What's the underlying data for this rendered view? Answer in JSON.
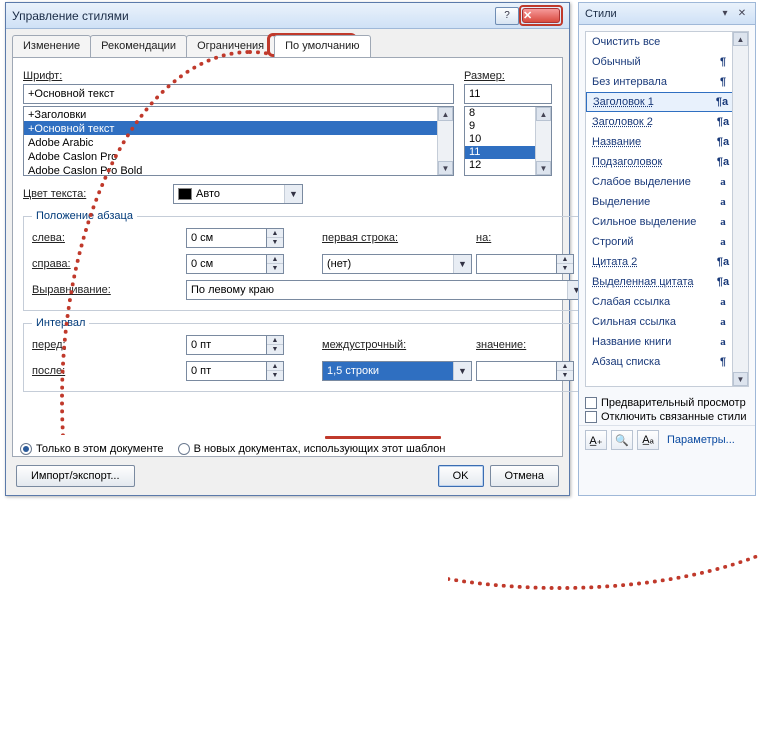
{
  "dialog": {
    "title": "Управление стилями",
    "tabs": [
      "Изменение",
      "Рекомендации",
      "Ограничения",
      "По умолчанию"
    ],
    "active_tab": 3,
    "font_label": "Шрифт:",
    "font_value": "+Основной текст",
    "font_list": [
      "+Заголовки",
      "+Основной текст",
      "Adobe Arabic",
      "Adobe Caslon Pro",
      "Adobe Caslon Pro Bold"
    ],
    "font_selected_index": 1,
    "size_label": "Размер:",
    "size_value": "11",
    "size_list": [
      "8",
      "9",
      "10",
      "11",
      "12"
    ],
    "size_selected_index": 3,
    "text_color_label": "Цвет текста:",
    "text_color_value": "Авто",
    "para_position_legend": "Положение абзаца",
    "left_label": "слева:",
    "left_value": "0 см",
    "right_label": "справа:",
    "right_value": "0 см",
    "firstline_label": "первая строка:",
    "firstline_value": "(нет)",
    "on_label": "на:",
    "on_value": "",
    "align_label": "Выравнивание:",
    "align_value": "По левому краю",
    "interval_legend": "Интервал",
    "before_label": "перед:",
    "before_value": "0 пт",
    "after_label": "после:",
    "after_value": "0 пт",
    "linespacing_label": "междустрочный:",
    "linespacing_value": "1,5 строки",
    "value_label": "значение:",
    "value_value": "",
    "radio_thisdoc": "Только в этом документе",
    "radio_newdocs": "В новых документах, использующих этот шаблон",
    "import_export": "Импорт/экспорт...",
    "ok": "OK",
    "cancel": "Отмена"
  },
  "panel": {
    "title": "Стили",
    "items": [
      {
        "name": "Очистить все",
        "mark": "",
        "cls": ""
      },
      {
        "name": "Обычный",
        "mark": "¶",
        "cls": ""
      },
      {
        "name": "Без интервала",
        "mark": "¶",
        "cls": ""
      },
      {
        "name": "Заголовок 1",
        "mark": "¶a",
        "cls": "sel und"
      },
      {
        "name": "Заголовок 2",
        "mark": "¶a",
        "cls": "und"
      },
      {
        "name": "Название",
        "mark": "¶a",
        "cls": "und"
      },
      {
        "name": "Подзаголовок",
        "mark": "¶a",
        "cls": "und"
      },
      {
        "name": "Слабое выделение",
        "mark": "a",
        "cls": "a"
      },
      {
        "name": "Выделение",
        "mark": "a",
        "cls": "a"
      },
      {
        "name": "Сильное выделение",
        "mark": "a",
        "cls": "a"
      },
      {
        "name": "Строгий",
        "mark": "a",
        "cls": "a"
      },
      {
        "name": "Цитата 2",
        "mark": "¶a",
        "cls": "und"
      },
      {
        "name": "Выделенная цитата",
        "mark": "¶a",
        "cls": "und"
      },
      {
        "name": "Слабая ссылка",
        "mark": "a",
        "cls": "a"
      },
      {
        "name": "Сильная ссылка",
        "mark": "a",
        "cls": "a"
      },
      {
        "name": "Название книги",
        "mark": "a",
        "cls": "a"
      },
      {
        "name": "Абзац списка",
        "mark": "¶",
        "cls": ""
      }
    ],
    "chk_preview": "Предварительный просмотр",
    "chk_disable_linked": "Отключить связанные стили",
    "options_link": "Параметры..."
  }
}
